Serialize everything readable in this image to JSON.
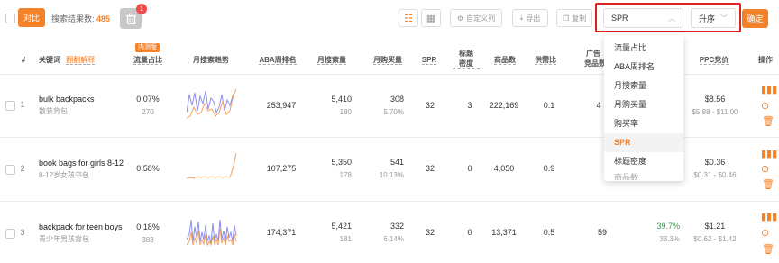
{
  "toolbar": {
    "compare_label": "对比",
    "result_label": "搜索结果数:",
    "result_count": "485",
    "trash_badge": "1",
    "custom_words_label": "自定义列",
    "export_label": "导出",
    "copy_label": "复制",
    "sort_field_value": "SPR",
    "sort_order_value": "升序",
    "confirm_label": "确定"
  },
  "header": {
    "index": "#",
    "keyword": "关键词",
    "keyword_link": "翻翻解释",
    "traffic_share": "流量占比",
    "traffic_tag": "内测版",
    "trend": "月搜索趋势",
    "aba_rank": "ABA周排名",
    "monthly_search": "月搜索量",
    "monthly_buy": "月购买量",
    "spr": "SPR",
    "title_density_1": "标题",
    "title_density_2": "密度",
    "product_count": "商品数",
    "supply_ratio": "供需比",
    "ad_1": "广告",
    "ad_2": "竞品数",
    "ppc": "PPC竞价",
    "actions": "操作"
  },
  "dropdown": {
    "items": [
      "流量占比",
      "ABA周排名",
      "月搜索量",
      "月购买量",
      "购买率",
      "SPR",
      "标题密度",
      "商品数"
    ],
    "selected": "SPR"
  },
  "rows": [
    {
      "index": "1",
      "keyword": "bulk backpacks",
      "keyword_cn": "散装背包",
      "traffic": "0.07%",
      "traffic_sub": "270",
      "aba_rank": "253,947",
      "search": "5,410",
      "search_sub": "180",
      "buy": "308",
      "buy_sub": "5.70%",
      "spr": "32",
      "density": "3",
      "products": "222,169",
      "supply": "0.1",
      "ad": "4",
      "click_share": "",
      "click_share_sub": "",
      "ppc": "$8.56",
      "ppc_range": "$5.88 - $11.00"
    },
    {
      "index": "2",
      "keyword": "book bags for girls 8-12",
      "keyword_cn": "8-12岁女孩书包",
      "traffic": "0.58%",
      "traffic_sub": "",
      "aba_rank": "107,275",
      "search": "5,350",
      "search_sub": "178",
      "buy": "541",
      "buy_sub": "10.13%",
      "spr": "32",
      "density": "0",
      "products": "4,050",
      "supply": "0.9",
      "ad": "",
      "click_share": "",
      "click_share_sub": "",
      "ppc": "$0.36",
      "ppc_range": "$0.31 - $0.46"
    },
    {
      "index": "3",
      "keyword": "backpack for teen boys",
      "keyword_cn": "青少年男孩背包",
      "traffic": "0.18%",
      "traffic_sub": "383",
      "aba_rank": "174,371",
      "search": "5,421",
      "search_sub": "181",
      "buy": "332",
      "buy_sub": "6.14%",
      "spr": "32",
      "density": "0",
      "products": "13,371",
      "supply": "0.5",
      "ad": "59",
      "click_share": "39.7%",
      "click_share_sub": "33.3%",
      "ppc": "$1.21",
      "ppc_range": "$0.62 - $1.42"
    }
  ],
  "colors": {
    "accent": "#f4822a",
    "highlight_frame": "#e0201c",
    "trend_blue": "#8a8ff0",
    "trend_orange": "#f4a062"
  }
}
